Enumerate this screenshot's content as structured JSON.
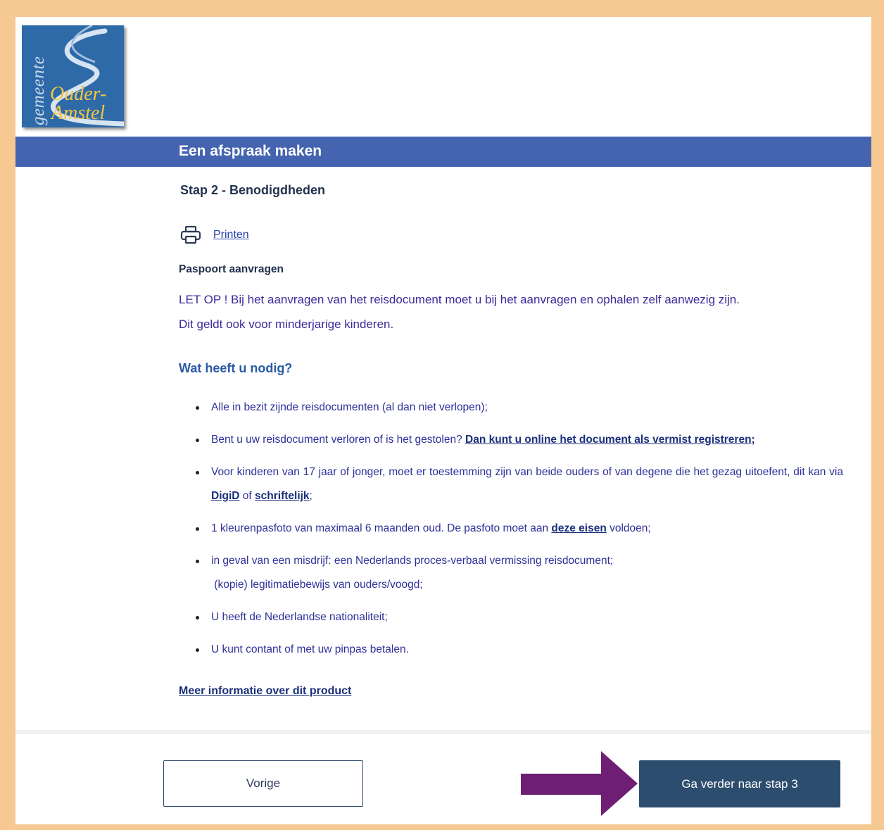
{
  "logo": {
    "word_vertical": "gemeente",
    "name_line1": "Ouder-",
    "name_line2": "Amstel"
  },
  "header": {
    "title": "Een afspraak maken"
  },
  "step": {
    "title": "Stap 2 - Benodigdheden"
  },
  "print": {
    "icon": "printer-icon",
    "label": "Printen"
  },
  "product": {
    "name": "Paspoort aanvragen"
  },
  "notice": {
    "line1": "LET OP ! Bij het aanvragen van het reisdocument moet u bij het aanvragen en ophalen zelf aanwezig zijn.",
    "line2": "Dit geldt ook voor minderjarige kinderen."
  },
  "requirements": {
    "heading": "Wat heeft u nodig?",
    "item1": "Alle in bezit zijnde reisdocumenten (al dan niet verlopen);",
    "item2_text": "Bent u uw reisdocument verloren of is het gestolen? ",
    "item2_link": "Dan kunt u online het document als vermist registreren;",
    "item3_text": "Voor kinderen van 17 jaar of jonger, moet er toestemming zijn van beide ouders of van degene die het gezag uitoefent, dit kan via ",
    "item3_link1": "DigiD",
    "item3_mid": " of ",
    "item3_link2": "schriftelijk",
    "item3_end": ";",
    "item4_text": "1 kleurenpasfoto van maximaal 6 maanden oud. De pasfoto moet aan ",
    "item4_link": "deze eisen",
    "item4_end": " voldoen;",
    "item5_line1": "in geval van een misdrijf: een Nederlands proces-verbaal vermissing reisdocument;",
    "item5_line2": " (kopie) legitimatiebewijs van ouders/voogd;",
    "item6": "U heeft de Nederlandse nationaliteit;",
    "item7": "U kunt contant of met uw pinpas betalen."
  },
  "more_info": "Meer informatie over dit product",
  "buttons": {
    "previous": "Vorige",
    "next": "Ga verder naar stap 3"
  },
  "colors": {
    "frame": "#f6c892",
    "header_bar": "#4564b0",
    "next_button": "#2c4d6e",
    "annotation_arrow": "#6e1f73"
  }
}
